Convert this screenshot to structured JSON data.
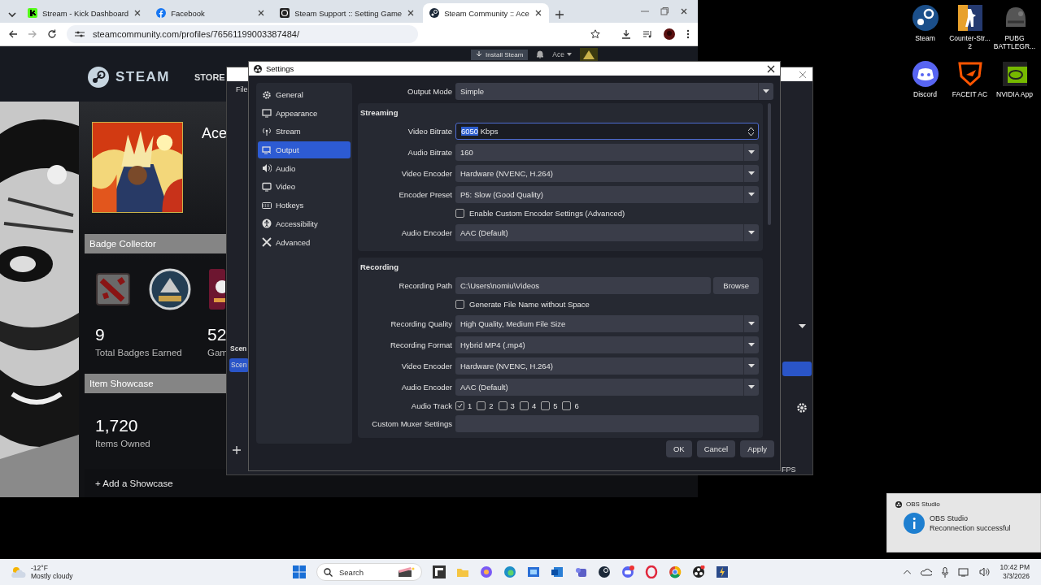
{
  "browser": {
    "tabs": [
      {
        "title": "Stream - Kick Dashboard",
        "selected": false
      },
      {
        "title": "Facebook",
        "selected": false
      },
      {
        "title": "Steam Support :: Setting Game",
        "selected": false
      },
      {
        "title": "Steam Community :: Ace",
        "selected": true
      }
    ],
    "address": "steamcommunity.com/profiles/76561199003387484/",
    "steam": {
      "logo": "STEAM",
      "nav": "STORE",
      "install": "Install Steam",
      "account": "Ace",
      "profile_name": "Ace",
      "badge_collector": {
        "title": "Badge Collector",
        "stats": [
          {
            "value": "9",
            "label": "Total Badges Earned"
          },
          {
            "value": "52",
            "label": "Gam"
          }
        ]
      },
      "item_showcase": {
        "title": "Item Showcase",
        "stats": [
          {
            "value": "1,720",
            "label": "Items Owned"
          }
        ]
      },
      "add_showcase": "+ Add a Showcase"
    }
  },
  "obs_main": {
    "menu": "File",
    "scenes_title": "Scen",
    "scene_item": "Scen",
    "fps": "FPS"
  },
  "settings": {
    "title": "Settings",
    "nav": [
      {
        "label": "General",
        "selected": false
      },
      {
        "label": "Appearance",
        "selected": false
      },
      {
        "label": "Stream",
        "selected": false
      },
      {
        "label": "Output",
        "selected": true
      },
      {
        "label": "Audio",
        "selected": false
      },
      {
        "label": "Video",
        "selected": false
      },
      {
        "label": "Hotkeys",
        "selected": false
      },
      {
        "label": "Accessibility",
        "selected": false
      },
      {
        "label": "Advanced",
        "selected": false
      }
    ],
    "output_mode": {
      "label": "Output Mode",
      "value": "Simple"
    },
    "groups": [
      {
        "title": "Streaming",
        "rows": [
          {
            "kind": "spin",
            "label": "Video Bitrate",
            "selected_text": "6050",
            "value": " Kbps"
          },
          {
            "kind": "select",
            "label": "Audio Bitrate",
            "value": "160"
          },
          {
            "kind": "select",
            "label": "Video Encoder",
            "value": "Hardware (NVENC, H.264)"
          },
          {
            "kind": "select",
            "label": "Encoder Preset",
            "value": "P5: Slow (Good Quality)"
          },
          {
            "kind": "checkbox",
            "label": "Enable Custom Encoder Settings (Advanced)",
            "checked": false
          },
          {
            "kind": "select",
            "label": "Audio Encoder",
            "value": "AAC (Default)"
          }
        ]
      },
      {
        "title": "Recording",
        "rows": [
          {
            "kind": "path",
            "label": "Recording Path",
            "value": "C:\\Users\\nomiu\\Videos",
            "button": "Browse"
          },
          {
            "kind": "checkbox",
            "label": "Generate File Name without Space",
            "checked": false
          },
          {
            "kind": "select",
            "label": "Recording Quality",
            "value": "High Quality, Medium File Size"
          },
          {
            "kind": "select",
            "label": "Recording Format",
            "value": "Hybrid MP4 (.mp4)"
          },
          {
            "kind": "select",
            "label": "Video Encoder",
            "value": "Hardware (NVENC, H.264)"
          },
          {
            "kind": "select",
            "label": "Audio Encoder",
            "value": "AAC (Default)"
          },
          {
            "kind": "tracks",
            "label": "Audio Track",
            "tracks": [
              {
                "label": "1",
                "checked": true
              },
              {
                "label": "2",
                "checked": false
              },
              {
                "label": "3",
                "checked": false
              },
              {
                "label": "4",
                "checked": false
              },
              {
                "label": "5",
                "checked": false
              },
              {
                "label": "6",
                "checked": false
              }
            ]
          },
          {
            "kind": "text",
            "label": "Custom Muxer Settings"
          }
        ]
      }
    ],
    "buttons": [
      "OK",
      "Cancel",
      "Apply"
    ]
  },
  "desktop_icons": [
    {
      "label": "Steam"
    },
    {
      "label": "Counter-Str... 2"
    },
    {
      "label": "PUBG BATTLEGR..."
    },
    {
      "label": "Discord"
    },
    {
      "label": "FACEIT AC"
    },
    {
      "label": "NVIDIA App"
    }
  ],
  "notification": {
    "app": "OBS Studio",
    "title": "OBS Studio",
    "message": "Reconnection successful"
  },
  "taskbar": {
    "temperature": "-12°F",
    "weather": "Mostly cloudy",
    "search": "Search",
    "time": "10:42 PM",
    "date": "3/3/2026"
  }
}
